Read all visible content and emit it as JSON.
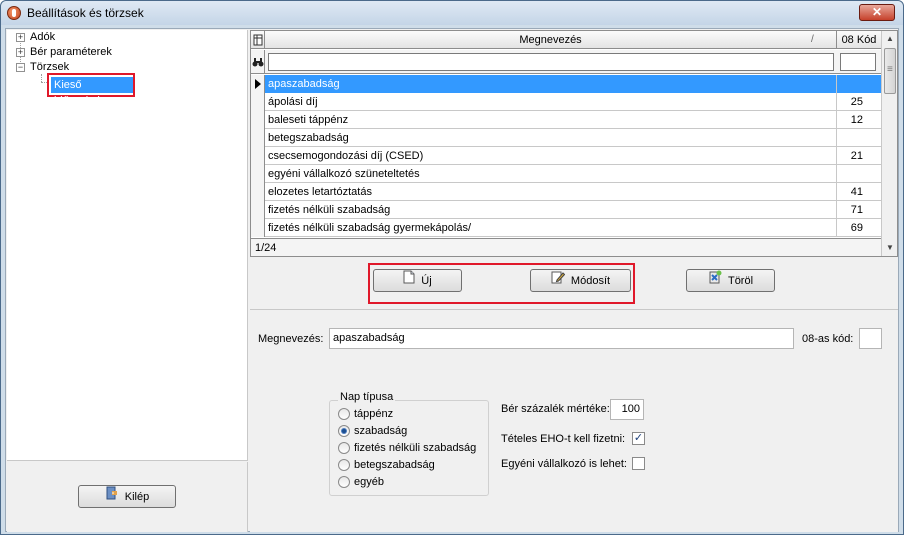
{
  "window": {
    "title": "Beállítások és törzsek",
    "close_label": "✕"
  },
  "tree": {
    "items": [
      {
        "label": "Adók",
        "expander": "+"
      },
      {
        "label": "Bér paraméterek",
        "expander": "+"
      },
      {
        "label": "Törzsek",
        "expander": "−"
      }
    ],
    "selected_child": "Kieső időszakok"
  },
  "exit_button": {
    "label": "Kilép"
  },
  "grid": {
    "columns": {
      "name": "Megnevezés",
      "code": "08 Kód",
      "sort_indicator": "/"
    },
    "filter_icon": "binoculars-icon",
    "rows": [
      {
        "name": "apaszabadság",
        "code": ""
      },
      {
        "name": "ápolási díj",
        "code": "25"
      },
      {
        "name": "baleseti táppénz",
        "code": "12"
      },
      {
        "name": "betegszabadság",
        "code": ""
      },
      {
        "name": "csecsemogondozási díj (CSED)",
        "code": "21"
      },
      {
        "name": "egyéni vállalkozó szüneteltetés",
        "code": ""
      },
      {
        "name": "elozetes letartóztatás",
        "code": "41"
      },
      {
        "name": "fizetés nélküli szabadság",
        "code": "71"
      },
      {
        "name": "fizetés nélküli szabadság gyermekápolás/",
        "code": "69"
      }
    ],
    "footer": "1/24"
  },
  "buttons": {
    "new": "Új",
    "modify": "Módosít",
    "delete": "Töröl"
  },
  "form": {
    "name_label": "Megnevezés:",
    "name_value": "apaszabadság",
    "code_label": "08-as kód:",
    "code_value": "",
    "day_type": {
      "title": "Nap típusa",
      "options": [
        "táppénz",
        "szabadság",
        "fizetés nélküli szabadság",
        "betegszabadság",
        "egyéb"
      ],
      "selected": "szabadság"
    },
    "wage_percent_label": "Bér százalék mértéke:",
    "wage_percent_value": "100",
    "eho_label": "Tételes EHO-t kell fizetni:",
    "eho_checked": true,
    "entrepreneur_label": "Egyéni vállalkozó is lehet:",
    "entrepreneur_checked": false
  },
  "colors": {
    "selection": "#3399ff",
    "highlight_frame": "#e0182a"
  }
}
